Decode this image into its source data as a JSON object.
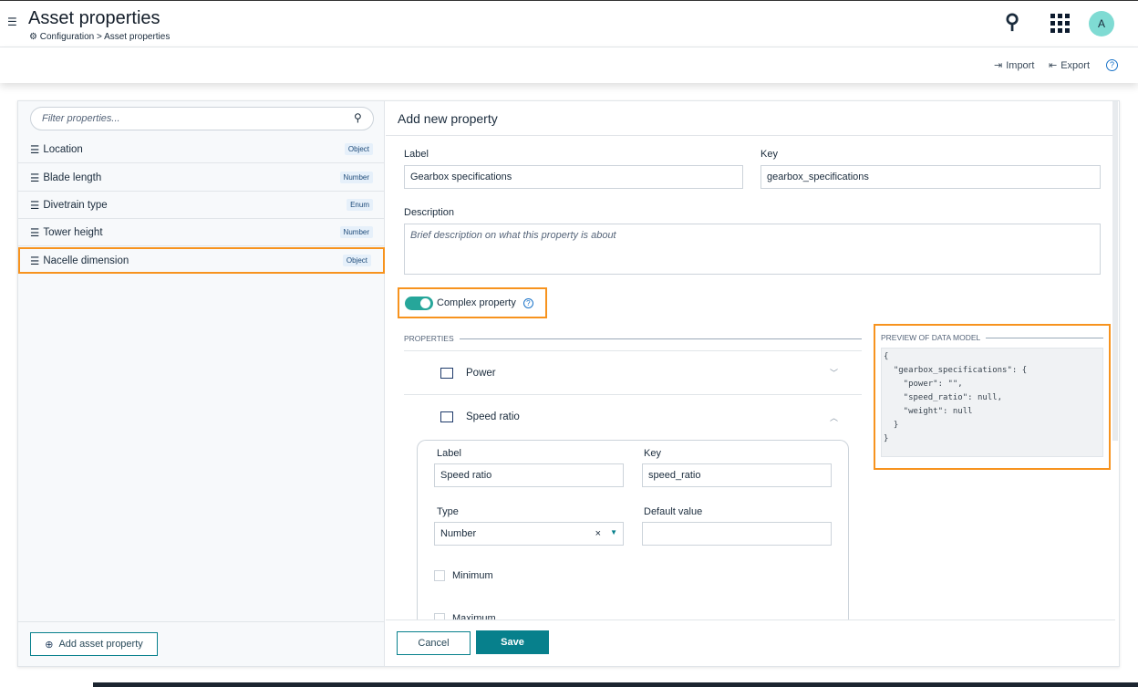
{
  "header": {
    "title": "Asset properties",
    "breadcrumb": "Configuration > Asset properties",
    "avatar": "A"
  },
  "toolbar": {
    "import": "Import",
    "export": "Export"
  },
  "left": {
    "filter_placeholder": "Filter properties...",
    "items": [
      {
        "label": "Location",
        "type": "Object"
      },
      {
        "label": "Blade length",
        "type": "Number"
      },
      {
        "label": "Divetrain type",
        "type": "Enum"
      },
      {
        "label": "Tower height",
        "type": "Number"
      },
      {
        "label": "Nacelle dimension",
        "type": "Object",
        "selected": true
      }
    ],
    "add_button": "Add asset property"
  },
  "form": {
    "title": "Add new property",
    "label_label": "Label",
    "label_value": "Gearbox specifications",
    "key_label": "Key",
    "key_value": "gearbox_specifications",
    "description_label": "Description",
    "description_placeholder": "Brief description on what this property is about",
    "complex_label": "Complex property",
    "complex_on": true,
    "properties_heading": "PROPERTIES",
    "properties": [
      {
        "label": "Power",
        "expanded": false
      },
      {
        "label": "Speed ratio",
        "expanded": true
      }
    ],
    "sub": {
      "label_label": "Label",
      "label_value": "Speed ratio",
      "key_label": "Key",
      "key_value": "speed_ratio",
      "type_label": "Type",
      "type_value": "Number",
      "default_label": "Default value",
      "default_value": "",
      "minimum": "Minimum",
      "maximum": "Maximum"
    },
    "preview_heading": "PREVIEW OF DATA MODEL",
    "preview": "{\n  \"gearbox_specifications\": {\n    \"power\": \"\",\n    \"speed_ratio\": null,\n    \"weight\": null\n  }\n}",
    "cancel": "Cancel",
    "save": "Save"
  },
  "colors": {
    "accent": "#07808c",
    "highlight": "#f7931e",
    "toggle": "#26a69a"
  }
}
